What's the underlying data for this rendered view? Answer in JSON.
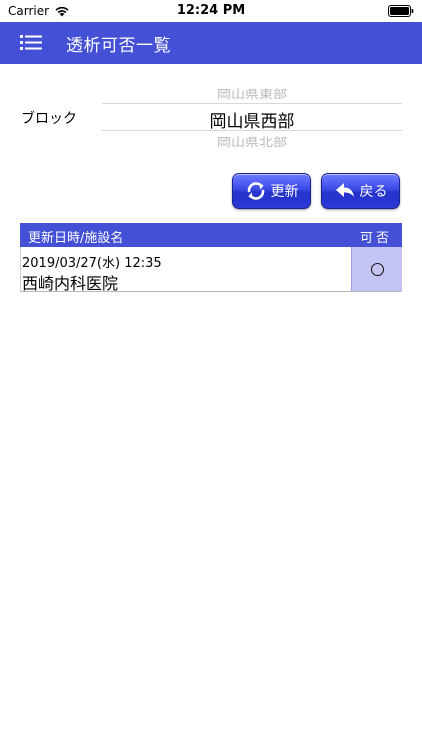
{
  "status_bar": {
    "carrier": "Carrier",
    "time": "12:24 PM",
    "icons": [
      "wifi-icon",
      "battery-icon"
    ]
  },
  "nav": {
    "title": "透析可否一覧",
    "menu_icon": "menu-icon"
  },
  "block_picker": {
    "label": "ブロック",
    "options_visible": [
      "岡山県東部",
      "岡山県西部",
      "岡山県北部"
    ],
    "selected": "岡山県西部"
  },
  "buttons": {
    "refresh_label": "更新",
    "refresh_icon": "refresh-icon",
    "back_label": "戻る",
    "back_icon": "back-arrow-icon"
  },
  "table": {
    "headers": {
      "name": "更新日時/施設名",
      "status": "可否"
    },
    "rows": [
      {
        "datetime": "2019/03/27(水) 12:35",
        "facility": "西崎内科医院",
        "status_mark": "circle"
      }
    ]
  },
  "colors": {
    "primary": "#4451d6",
    "status_cell": "#c4c4f4"
  }
}
